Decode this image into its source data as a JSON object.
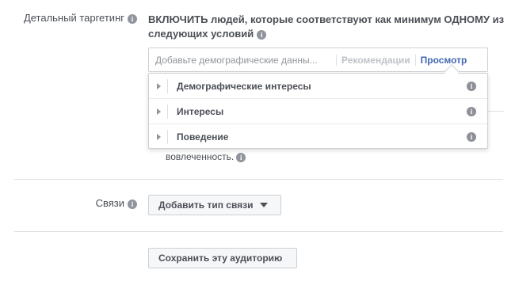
{
  "detailed_targeting": {
    "label": "Детальный таргетинг",
    "heading": "ВКЛЮЧИТЬ людей, которые соответствуют как минимум ОДНОМУ из следующих условий",
    "search": {
      "placeholder": "Добавьте демографические данны...",
      "value": "",
      "recommendations_label": "Рекомендации",
      "browse_label": "Просмотр"
    },
    "dropdown_items": [
      {
        "label": "Демографические интересы"
      },
      {
        "label": "Интересы"
      },
      {
        "label": "Поведение"
      }
    ],
    "partial_text": "вовлеченность."
  },
  "connections": {
    "label": "Связи",
    "add_button_label": "Добавить тип связи"
  },
  "save_button_label": "Сохранить эту аудиторию",
  "icons": {
    "info": "info-icon",
    "dropdown": "caret-down-icon",
    "expand": "chevron-right-icon"
  },
  "colors": {
    "link": "#4267b2",
    "muted_link": "#bec2c9",
    "text": "#4b4f56",
    "border": "#ccd0d5"
  }
}
